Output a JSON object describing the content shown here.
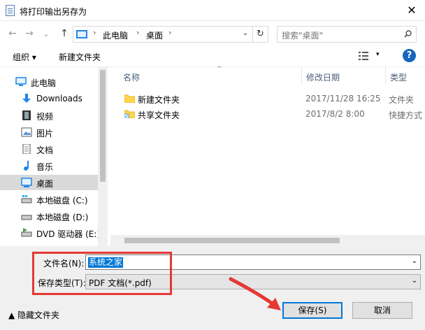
{
  "window": {
    "title": "将打印输出另存为",
    "close_glyph": "✕"
  },
  "nav": {
    "back": "←",
    "forward": "→",
    "recent": "⌄",
    "up": "↑",
    "crumbs": [
      "此电脑",
      "桌面"
    ],
    "sep": "›",
    "refresh": "↻",
    "search_placeholder": "搜索\"桌面\""
  },
  "toolbar": {
    "organize": "组织 ▾",
    "new_folder": "新建文件夹",
    "view_drop": "▾",
    "help": "?"
  },
  "sidebar": {
    "items": [
      {
        "label": "此电脑",
        "icon": "pc-icon"
      },
      {
        "label": "Downloads",
        "icon": "download-icon"
      },
      {
        "label": "视频",
        "icon": "video-icon"
      },
      {
        "label": "图片",
        "icon": "picture-icon"
      },
      {
        "label": "文档",
        "icon": "document-icon"
      },
      {
        "label": "音乐",
        "icon": "music-icon"
      },
      {
        "label": "桌面",
        "icon": "desktop-icon",
        "selected": true
      },
      {
        "label": "本地磁盘 (C:)",
        "icon": "drive-icon"
      },
      {
        "label": "本地磁盘 (D:)",
        "icon": "drive-icon"
      },
      {
        "label": "DVD 驱动器 (E:)",
        "icon": "dvd-icon"
      }
    ]
  },
  "filelist": {
    "headers": {
      "name": "名称",
      "date": "修改日期",
      "type": "类型"
    },
    "sort_glyph": "^",
    "rows": [
      {
        "name": "新建文件夹",
        "date": "2017/11/28 16:25",
        "type": "文件夹",
        "icon": "folder-icon"
      },
      {
        "name": "共享文件夹",
        "date": "2017/8/2 8:00",
        "type": "快捷方式",
        "icon": "shortcut-folder-icon"
      }
    ]
  },
  "form": {
    "filename_label": "文件名(N):",
    "filename_value": "系统之家",
    "filetype_label": "保存类型(T):",
    "filetype_value": "PDF 文档(*.pdf)",
    "drop": "⌄",
    "hide_folders": "▲ 隐藏文件夹",
    "save": "保存(S)",
    "cancel": "取消"
  },
  "colors": {
    "annotation": "#e53935",
    "accent": "#0078d7"
  }
}
